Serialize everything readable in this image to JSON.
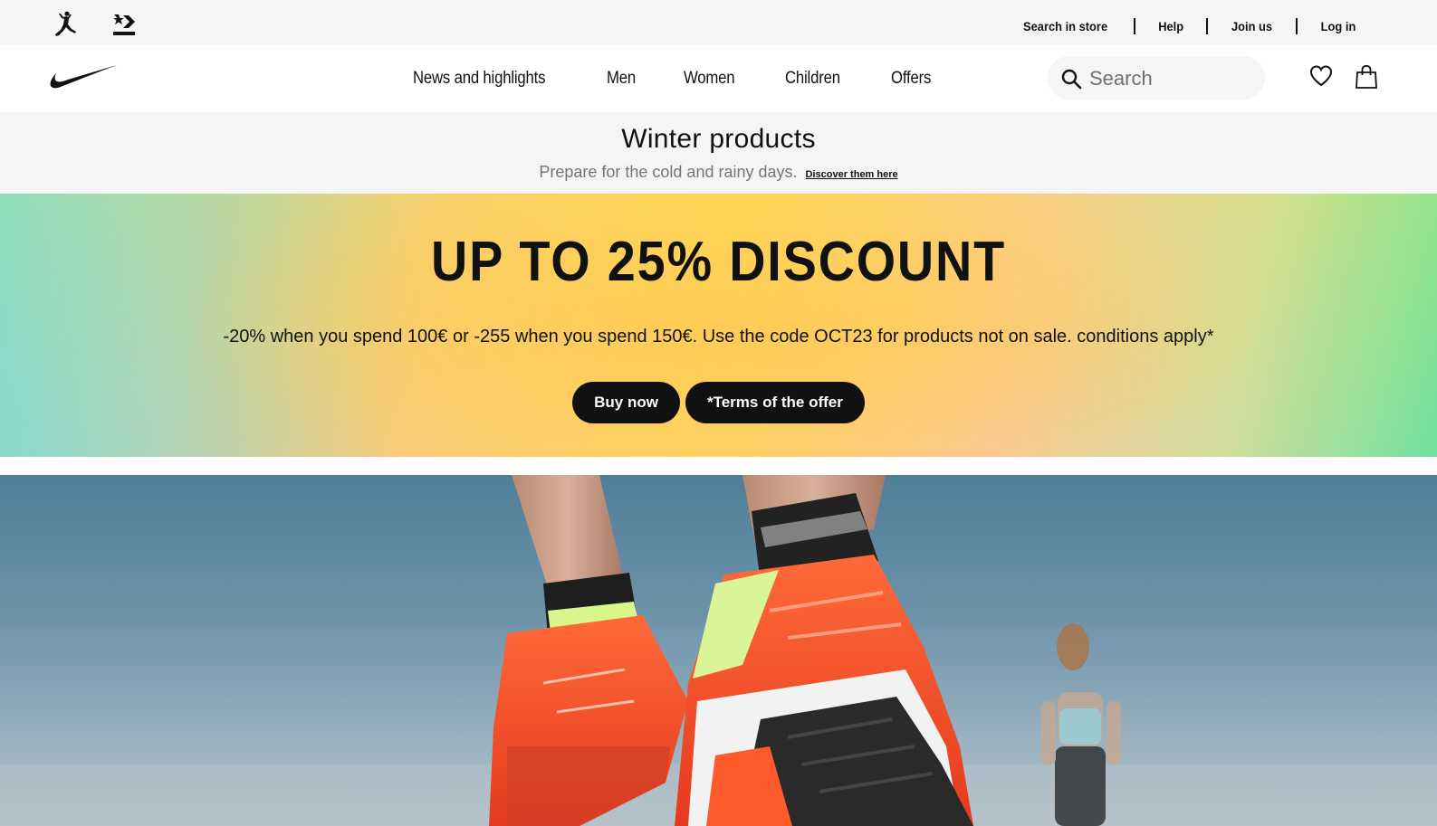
{
  "utility_bar": {
    "brands": [
      {
        "name": "jordan-logo"
      },
      {
        "name": "converse-logo",
        "label": "CONVERSE"
      }
    ],
    "links": [
      "Search in store",
      "Help",
      "Join us",
      "Log in"
    ]
  },
  "main_nav": {
    "logo": "nike-swoosh",
    "items": [
      "News and highlights",
      "Men",
      "Women",
      "Children",
      "Offers"
    ],
    "search": {
      "placeholder": "Search",
      "value": ""
    },
    "icons": [
      "heart-icon",
      "bag-icon"
    ]
  },
  "promo_strip": {
    "title": "Winter products",
    "text": "Prepare for the cold and rainy days.",
    "link": "Discover them here"
  },
  "discount_banner": {
    "headline": "UP TO 25% DISCOUNT",
    "text": "-20% when you spend 100€ or -255 when you spend 150€. Use the code OCT23 for products not on sale. conditions apply*",
    "buttons": [
      "Buy now",
      "*Terms of the offer"
    ]
  },
  "hero": {
    "image": "running-shoes-photo"
  },
  "colors": {
    "text": "#111111",
    "bar_bg": "#f5f5f5",
    "button": "#111111",
    "shoe": "#ff5a2c"
  }
}
